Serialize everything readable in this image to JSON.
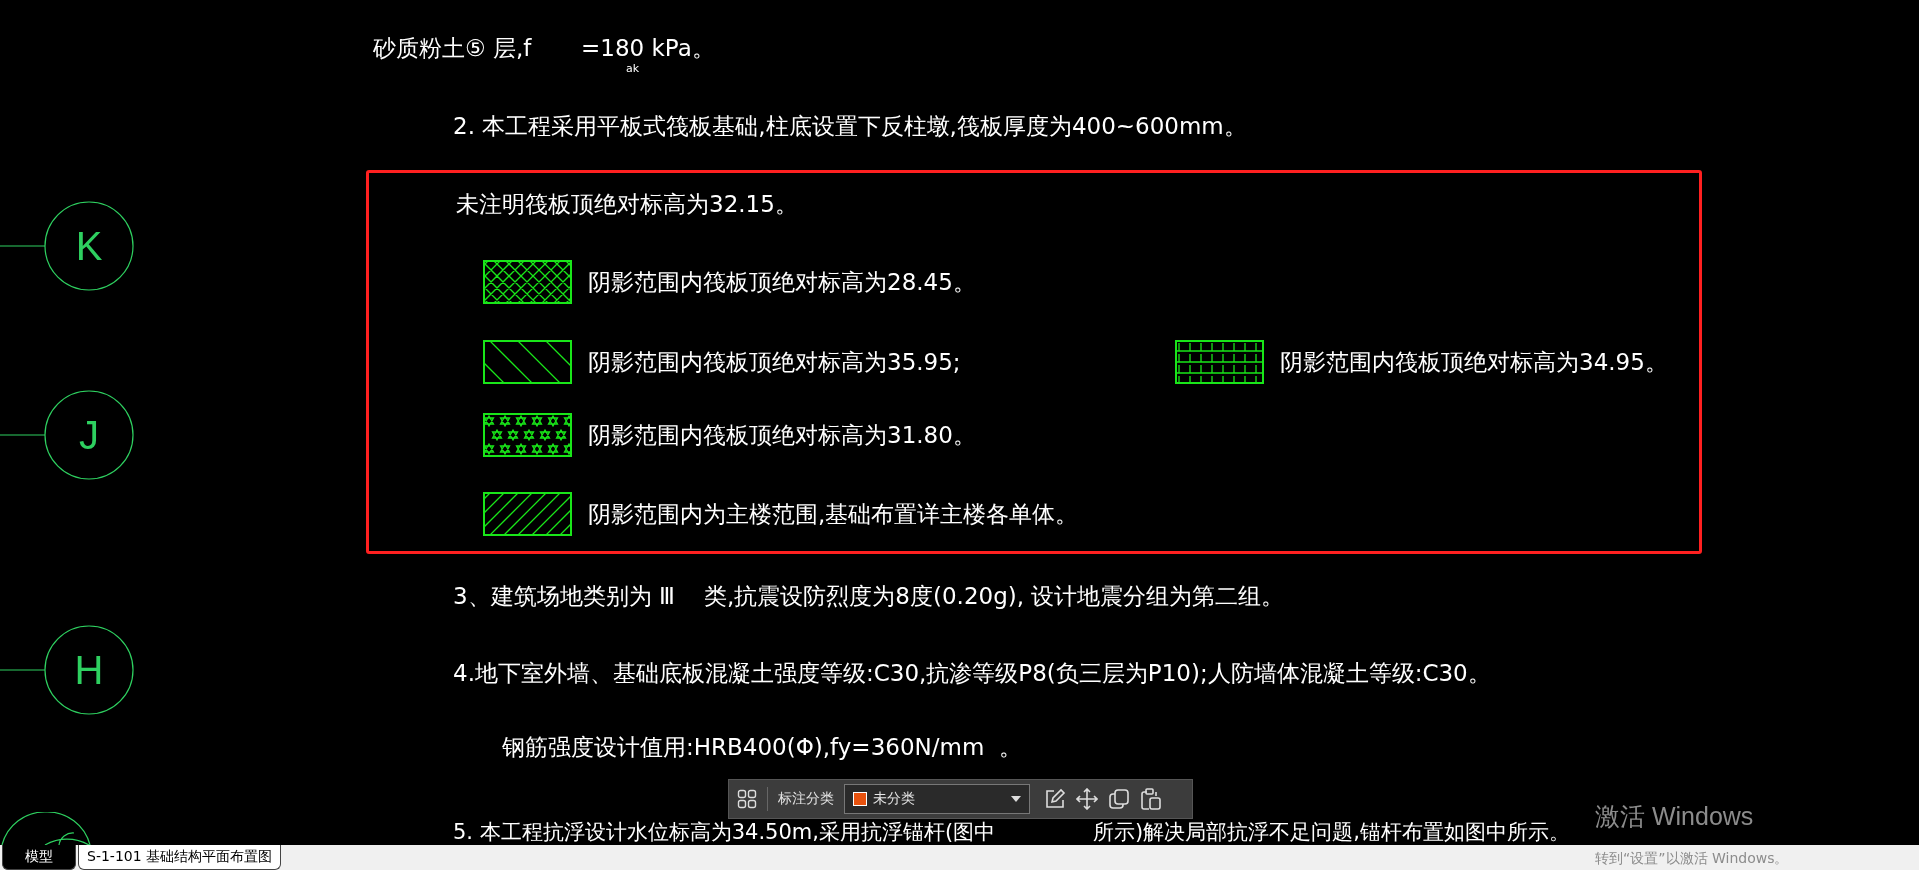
{
  "drawing": {
    "grid_axes": [
      {
        "label": "K"
      },
      {
        "label": "J"
      },
      {
        "label": "H"
      }
    ],
    "notes_top": [
      {
        "kind": "plain",
        "text": "砂质粉土⑤ 层,f"
      },
      {
        "kind": "subscript",
        "text": "ak"
      },
      {
        "kind": "plain",
        "text": "=180 kPa。"
      },
      {
        "kind": "plain",
        "text": "2. 本工程采用平板式筏板基础,柱底设置下反柱墩,筏板厚度为400~600mm。"
      }
    ],
    "highlight_box": {
      "intro": "未注明筏板顶绝对标高为32.15。",
      "legend": [
        {
          "kind": "crosshatch",
          "text": "阴影范围内筏板顶绝对标高为28.45。"
        },
        {
          "kind": "wide-diagonal",
          "text": "阴影范围内筏板顶绝对标高为35.95;"
        },
        {
          "kind": "stars",
          "text": "阴影范围内筏板顶绝对标高为31.80。"
        },
        {
          "kind": "diagonal",
          "text": "阴影范围内为主楼范围,基础布置详主楼各单体。"
        },
        {
          "kind": "brick",
          "text": "阴影范围内筏板顶绝对标高为34.95。"
        }
      ]
    },
    "notes_bottom": [
      {
        "text": "3、建筑场地类别为 Ⅲ    类,抗震设防烈度为8度(0.20g), 设计地震分组为第二组。"
      },
      {
        "text": "4.地下室外墙、基础底板混凝土强度等级:C30,抗渗等级P8(负三层为P10);人防墙体混凝土等级:C30。"
      },
      {
        "text": "钢筋强度设计值用:HRB400(Φ),fy=360N/mm  。"
      },
      {
        "text": "5. 本工程抗浮设计水位标高为34.50m,采用抗浮锚杆(图中"
      },
      {
        "text": "所示)解决局部抗浮不足问题,锚杆布置如图中所示。"
      }
    ]
  },
  "toolbar": {
    "label": "标注分类",
    "category": {
      "value": "未分类",
      "color": "#e8520e"
    }
  },
  "tabs": [
    {
      "label": "模型",
      "selected": true
    },
    {
      "label": "S-1-101 基础结构平面布置图",
      "selected": false
    }
  ],
  "activation_notice": {
    "title": "激活 Windows",
    "hint": "转到“设置”以激活 Windows。"
  }
}
